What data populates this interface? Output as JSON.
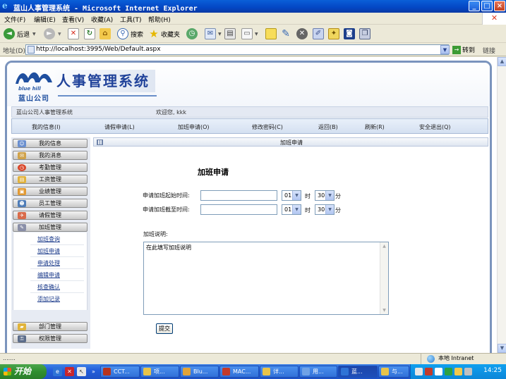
{
  "window": {
    "title": "蓝山人事管理系统 - Microsoft Internet Explorer",
    "minimize": "_",
    "maximize": "□",
    "close": "×"
  },
  "menu": [
    "文件(F)",
    "编辑(E)",
    "查看(V)",
    "收藏(A)",
    "工具(T)",
    "帮助(H)"
  ],
  "toolbar": {
    "back_label": "后退",
    "search_label": "搜索",
    "favorites_label": "收藏夹"
  },
  "address": {
    "label": "地址(D)",
    "url": "http://localhost:3995/Web/Default.aspx",
    "go_label": "转到",
    "links_label": "链接"
  },
  "page": {
    "logo_en": "blue hill",
    "logo_cn": "蓝山公司",
    "system_title": "人事管理系统",
    "info_system": "蓝山公司人事管理系统",
    "welcome": "欢迎您, kkk",
    "nav": [
      "我的信息(I)",
      "请假申请(L)",
      "加班申请(O)",
      "修改密码(C)",
      "返回(B)",
      "刷新(R)",
      "安全退出(Q)"
    ],
    "sidebar": {
      "items_top": [
        "我的信息",
        "我的消息",
        "考勤管理",
        "工资管理",
        "业绩管理",
        "员工管理",
        "请假管理",
        "加班管理"
      ],
      "sub_items": [
        "加班查询",
        "加班申请",
        "申请处理",
        "编辑申请",
        "核查确认",
        "添加记录"
      ],
      "items_bottom": [
        "部门管理",
        "权限管理"
      ]
    },
    "panel_title": "加班申请",
    "form": {
      "title": "加班申请",
      "start_label": "申请加班起始时间:",
      "end_label": "申请加班截至时间:",
      "hour_value": "01",
      "hour_unit": "时",
      "minute_value": "30",
      "minute_unit": "分",
      "desc_label": "加班说明:",
      "desc_text": "在此填写加班说明",
      "submit_label": "提交"
    }
  },
  "status": {
    "left": ".......",
    "zone": "本地 Intranet"
  },
  "taskbar": {
    "start": "开始",
    "tasks": [
      "CCT...",
      "项...",
      "Blu...",
      "MAC...",
      "详...",
      "用...",
      "蓝...",
      "与..."
    ],
    "clock": "14:25"
  }
}
